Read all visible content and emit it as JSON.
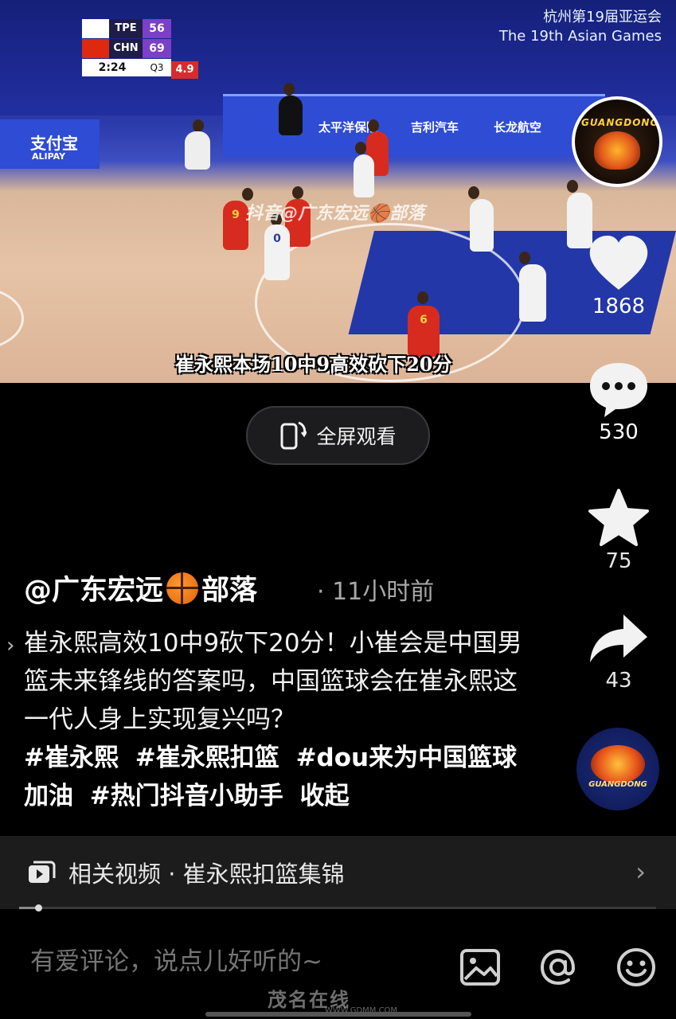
{
  "video": {
    "scoreboard": {
      "team1": {
        "name": "TPE",
        "score": "56"
      },
      "team2": {
        "name": "CHN",
        "score": "69"
      },
      "clock": "2:24",
      "quarter": "Q3",
      "shot_clock": "4.9"
    },
    "event_title_line1": "杭州第19届亚运会",
    "event_title_line2": "The 19th Asian Games",
    "sponsor_alipay": "支付宝",
    "sponsor_alipay_en": "ALIPAY",
    "sponsor_geely": "吉利汽车",
    "sponsor_loongair": "长龙航空",
    "sponsor_cpic": "太平洋保险",
    "watermark": "抖音@广东宏远🏀部落",
    "caption": "崔永熙本场10中9高效砍下20分",
    "jersey_red_1": "9",
    "jersey_white_1": "0",
    "jersey_red_2": "6"
  },
  "rail": {
    "avatar_logo": "GUANGDONG",
    "likes": "1868",
    "comments": "530",
    "favorites": "75",
    "shares": "43",
    "avatar_bottom_logo": "GUANGDONG"
  },
  "fullscreen": {
    "label": "全屏观看"
  },
  "post": {
    "author": "@广东宏远",
    "author_suffix": "部落",
    "timestamp": "· 11小时前",
    "description": "崔永熙高效10中9砍下20分！小崔会是中国男篮未来锋线的答案吗，中国篮球会在崔永熙这一代人身上实现复兴吗？",
    "tags": [
      "#崔永熙",
      "#崔永熙扣篮",
      "#dou来为中国篮球加油",
      "#热门抖音小助手"
    ],
    "collapse_label": "收起"
  },
  "related": {
    "label": "相关视频 · 崔永熙扣篮集锦"
  },
  "progress": {
    "fraction": 0.03
  },
  "comment": {
    "placeholder": "有爱评论，说点儿好听的~"
  },
  "site": {
    "name": "茂名在线",
    "url": "WWW.GDMM.COM"
  },
  "colors": {
    "background": "#000000",
    "accent_purple": "#7b3fc8",
    "accent_red": "#d62c2c"
  }
}
